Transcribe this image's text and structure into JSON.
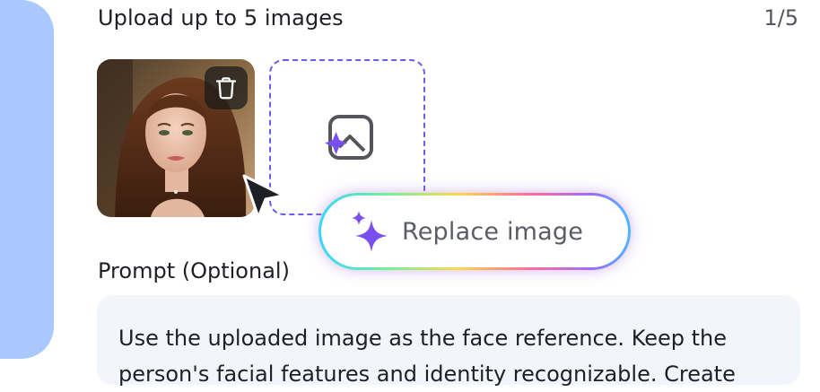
{
  "upload": {
    "title": "Upload up to 5 images",
    "counter": "1/5"
  },
  "thumbnail": {
    "delete_icon": "trash-icon",
    "image": "portrait-photo"
  },
  "dropzone": {
    "icon": "add-image-icon"
  },
  "replace_button": {
    "label": "Replace image",
    "icon": "sparkle-icon"
  },
  "prompt": {
    "label": "Prompt (Optional)",
    "text": "Use the uploaded image as the face reference. Keep the person's facial features and identity recognizable. Create"
  },
  "colors": {
    "accent_purple": "#6b5cf0",
    "side_accent": "#a9c8ff",
    "prompt_bg": "#f3f5fd"
  }
}
